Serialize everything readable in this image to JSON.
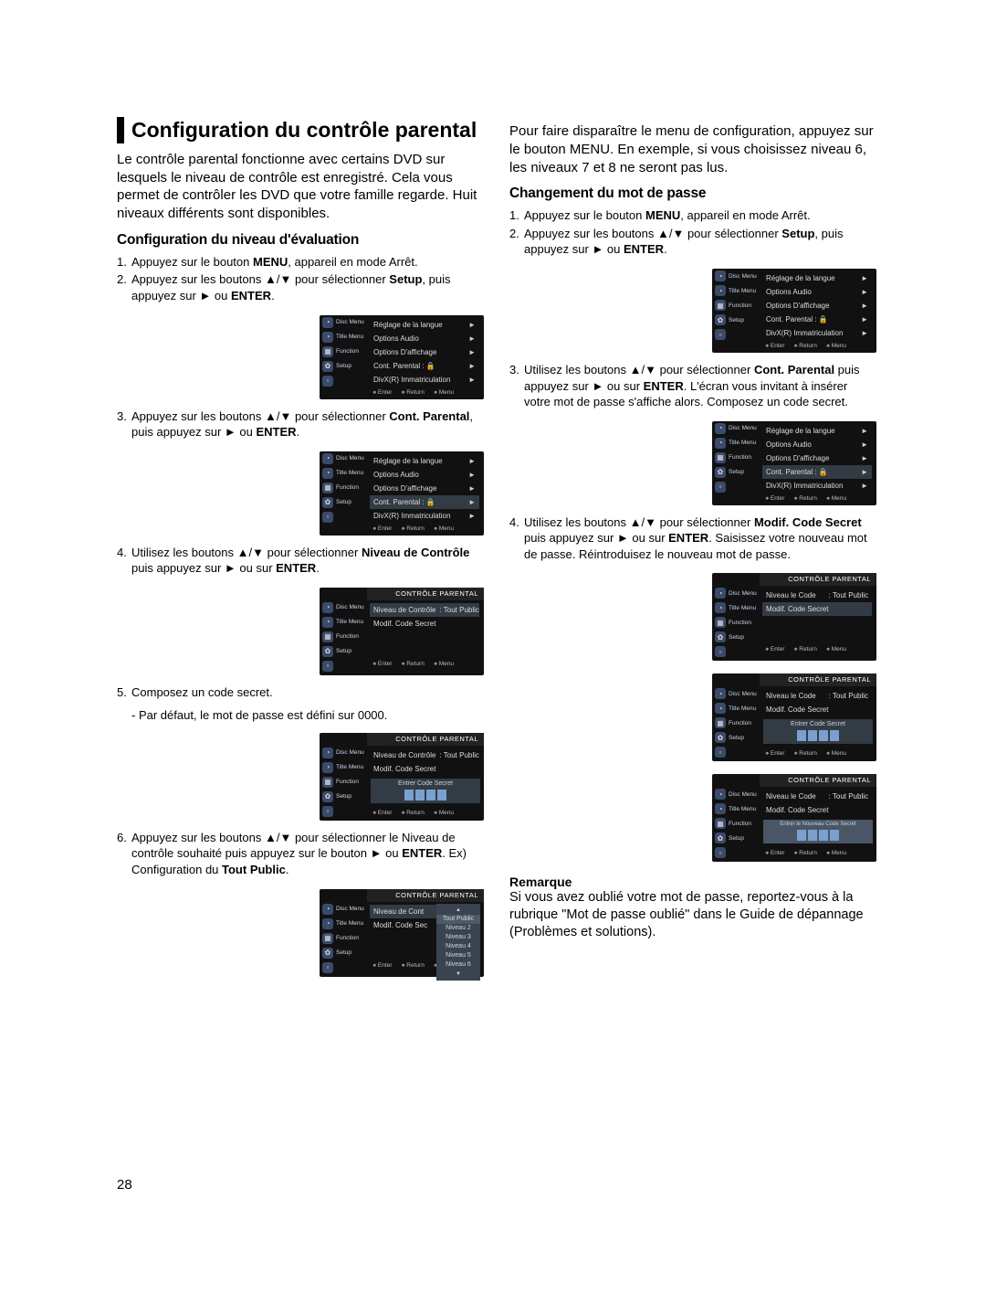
{
  "page_number": "28",
  "tri_up": "▲",
  "tri_down": "▼",
  "tri_updown": "▲/▼",
  "tri_right": "►",
  "left": {
    "h1": "Configuration du contrôle parental",
    "intro": "Le contrôle parental fonctionne avec certains DVD sur lesquels le niveau de contrôle est enregistré. Cela vous permet de contrôler les DVD que votre famille regarde. Huit niveaux différents sont disponibles.",
    "h2": "Configuration du niveau d'évaluation",
    "s1_a": "Appuyez sur le bouton ",
    "s1_b": "MENU",
    "s1_c": ", appareil en mode Arrêt.",
    "s2_a": "Appuyez sur les boutons ",
    "s2_b": " pour sélectionner ",
    "s2_c": "Setup",
    "s2_d": ", puis appuyez sur ",
    "s2_e": " ou ",
    "s2_f": "ENTER",
    "s2_g": ".",
    "s3_a": "Appuyez sur les boutons ",
    "s3_b": " pour sélectionner ",
    "s3_c": "Cont. Parental",
    "s3_d": ", puis appuyez sur ",
    "s3_e": " ou ",
    "s3_f": "ENTER",
    "s3_g": ".",
    "s4_a": "Utilisez les boutons ",
    "s4_b": " pour sélectionner ",
    "s4_c": "Niveau de Contrôle",
    "s4_d": " puis appuyez sur ",
    "s4_e": " ou sur ",
    "s4_f": "ENTER",
    "s4_g": ".",
    "s5_a": "Composez un code secret.",
    "s5_sub": "- Par défaut, le mot de passe est défini sur 0000.",
    "s6_a": "Appuyez sur les boutons ",
    "s6_b": " pour sélectionner le Niveau de contrôle souhaité puis appuyez sur le bouton ",
    "s6_c": " ou ",
    "s6_d": "ENTER",
    "s6_e": ". Ex) Configuration du ",
    "s6_f": "Tout Public",
    "s6_g": "."
  },
  "right": {
    "intro": "Pour faire disparaître le menu de configuration, appuyez sur le bouton MENU. En exemple, si vous choisissez niveau 6, les niveaux 7 et 8 ne seront pas lus.",
    "h2": "Changement du mot de passe",
    "s1_a": "Appuyez sur le bouton ",
    "s1_b": "MENU",
    "s1_c": ", appareil en mode Arrêt.",
    "s2_a": "Appuyez sur les boutons ",
    "s2_b": " pour sélectionner ",
    "s2_c": "Setup",
    "s2_d": ", puis appuyez sur ",
    "s2_e": " ou ",
    "s2_f": "ENTER",
    "s2_g": ".",
    "s3_a": "Utilisez les boutons ",
    "s3_b": " pour sélectionner ",
    "s3_c": "Cont. Parental",
    "s3_d": " puis appuyez sur ",
    "s3_e": " ou sur ",
    "s3_f": "ENTER",
    "s3_g": ". L'écran vous invitant à insérer votre mot de passe s'affiche alors. Composez un code secret.",
    "s4_a": "Utilisez les boutons ",
    "s4_b": " pour sélectionner ",
    "s4_c": "Modif. Code Secret",
    "s4_d": " puis appuyez sur ",
    "s4_e": " ou sur ",
    "s4_f": "ENTER",
    "s4_g": ". Saisissez votre nouveau mot de passe. Réintroduisez le nouveau mot de passe.",
    "remarque_h": "Remarque",
    "remarque": "Si vous avez oublié votre mot de passe, reportez-vous à la rubrique \"Mot de passe oublié\" dans le Guide de dépannage (Problèmes et solutions)."
  },
  "menu": {
    "side": [
      "Disc Menu",
      "Title Menu",
      "Function",
      "Setup",
      ""
    ],
    "setup_rows": [
      "Réglage de la langue",
      "Options Audio",
      "Options D'affichage",
      "Cont. Parental :",
      "DivX(R) Immatriculation"
    ],
    "parental_title": "CONTRÔLE PARENTAL",
    "niveau_controle": "Niveau de Contrôle",
    "niveau_code": "Niveau le Code",
    "tout_public": ": Tout Public",
    "modif_code": "Modif. Code Secret",
    "entrer_code": "Entrer Code Secret",
    "entrer_nouveau": "Entrer le Nouveau Code Secret",
    "niveau_cont_short": "Niveau de Cont",
    "modif_code_short": "Modif. Code Sec",
    "dropdown": [
      "Tout Public",
      "Niveau 2",
      "Niveau 3",
      "Niveau 4",
      "Niveau 5",
      "Niveau 6"
    ],
    "footer": [
      "Enter",
      "Return",
      "Menu"
    ],
    "lock": "🔒"
  }
}
